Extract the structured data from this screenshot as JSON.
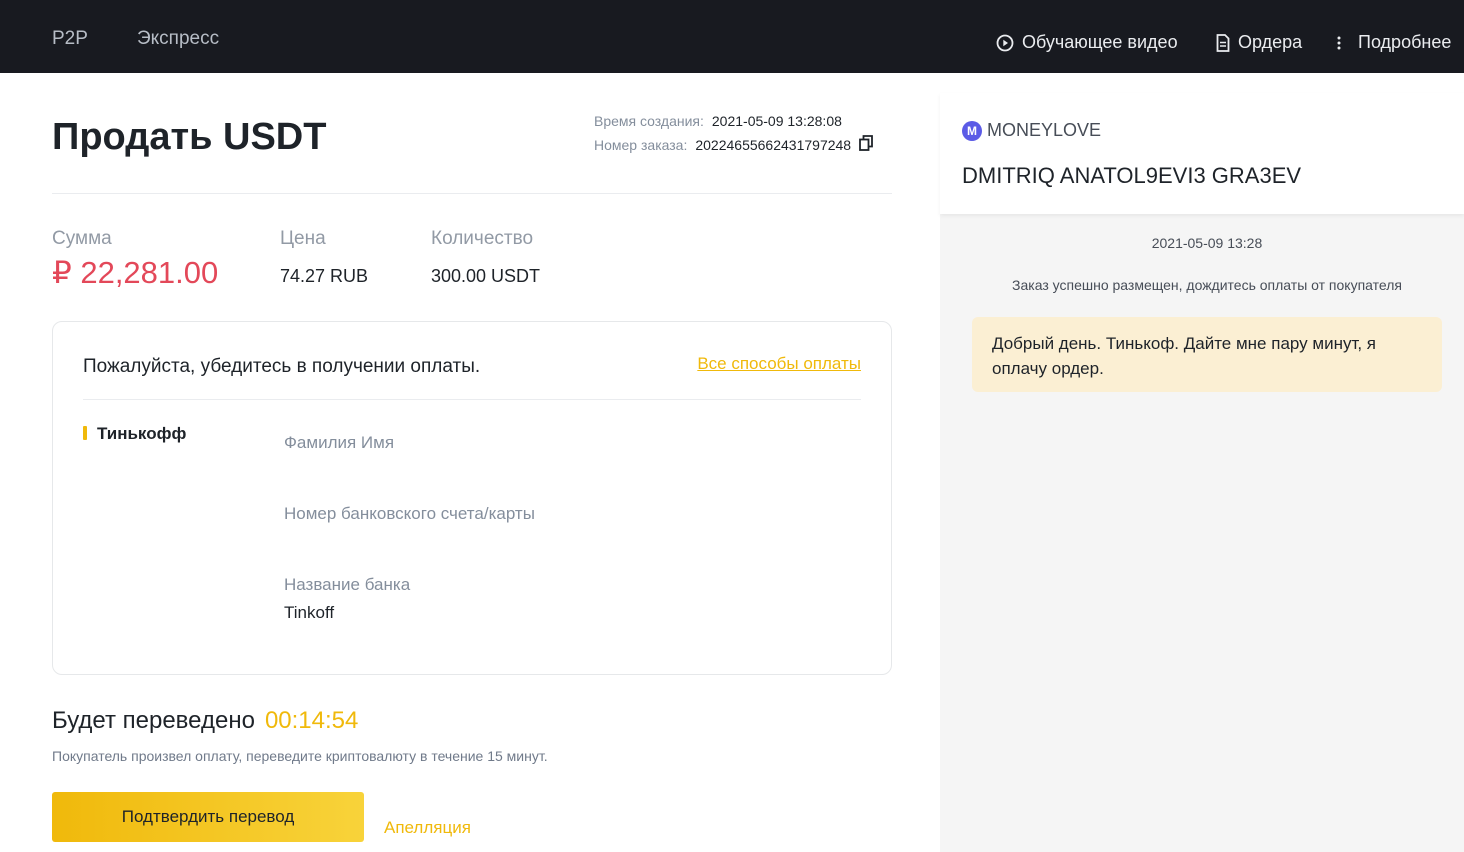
{
  "nav": {
    "tabs": [
      "P2P",
      "Экспресс"
    ],
    "video": "Обучающее видео",
    "orders": "Ордера",
    "more": "Подробнее"
  },
  "order": {
    "title": "Продать USDT",
    "created_label": "Время создания:",
    "created_value": "2021-05-09 13:28:08",
    "number_label": "Номер заказа:",
    "number_value": "20224655662431797248"
  },
  "stats": {
    "amount_label": "Сумма",
    "amount_value": "₽ 22,281.00",
    "price_label": "Цена",
    "price_value": "74.27 RUB",
    "qty_label": "Количество",
    "qty_value": "300.00 USDT"
  },
  "payment": {
    "title": "Пожалуйста, убедитесь в получении оплаты.",
    "all_methods": "Все способы оплаты",
    "method": "Тинькофф",
    "fields": [
      {
        "label": "Фамилия Имя",
        "value": ""
      },
      {
        "label": "Номер банковского счета/карты",
        "value": ""
      },
      {
        "label": "Название банка",
        "value": "Tinkoff"
      }
    ]
  },
  "transfer": {
    "title": "Будет переведено",
    "timer": "00:14:54",
    "note": "Покупатель произвел оплату, переведите криптовалюту в течение 15 минут.",
    "confirm": "Подтвердить перевод",
    "appeal": "Апелляция"
  },
  "chat": {
    "avatar_letter": "M",
    "nickname": "MONEYLOVE",
    "real_name": "DMITRIQ ANATOL9EVI3 GRA3EV",
    "time": "2021-05-09 13:28",
    "system_message": "Заказ успешно размещен, дождитесь оплаты от покупателя",
    "message": "Добрый день. Тинькоф. Дайте мне пару минут, я оплачу ордер."
  },
  "colors": {
    "accent": "#f0b90b",
    "amount": "#e34859",
    "topbar": "#181a20"
  }
}
